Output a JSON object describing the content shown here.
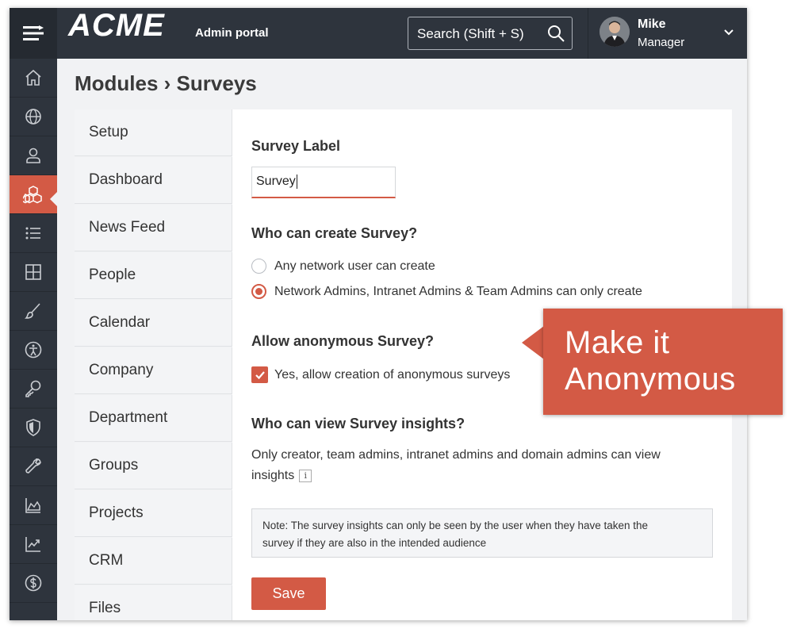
{
  "header": {
    "logo": "ACME",
    "portal_label": "Admin portal",
    "search_label": "Search (Shift + S)",
    "user_name": "Mike",
    "user_role": "Manager"
  },
  "rail_icons": [
    "home-icon",
    "globe-icon",
    "user-icon",
    "cubes-icon",
    "list-icon",
    "grid-icon",
    "brush-icon",
    "accessibility-icon",
    "key-icon",
    "shield-icon",
    "wrench-icon",
    "area-chart-icon",
    "line-chart-icon",
    "dollar-icon"
  ],
  "breadcrumb": "Modules › Surveys",
  "subnav": [
    "Setup",
    "Dashboard",
    "News Feed",
    "People",
    "Calendar",
    "Company",
    "Department",
    "Groups",
    "Projects",
    "CRM",
    "Files"
  ],
  "form": {
    "survey_label_heading": "Survey Label",
    "survey_label_value": "Survey",
    "create_heading": "Who can create Survey?",
    "create_options": [
      "Any network user can create",
      "Network Admins, Intranet Admins & Team Admins can only create"
    ],
    "create_selected": "Network Admins, Intranet Admins & Team Admins can only create",
    "anon_heading": "Allow anonymous Survey?",
    "anon_checkbox": "Yes, allow creation of anonymous surveys",
    "anon_checked": true,
    "insights_heading": "Who can view Survey insights?",
    "insights_desc": "Only creator, team admins, intranet admins and domain admins can view insights",
    "info_glyph": "i",
    "note_line1": "Note: The survey insights can only be seen by the user when they have taken the",
    "note_line2": "survey if they are also in the intended audience",
    "save_label": "Save"
  },
  "callout": {
    "line1": "Make it",
    "line2": "Anonymous"
  },
  "colors": {
    "accent": "#d35a45",
    "topbar": "#2e343d"
  }
}
